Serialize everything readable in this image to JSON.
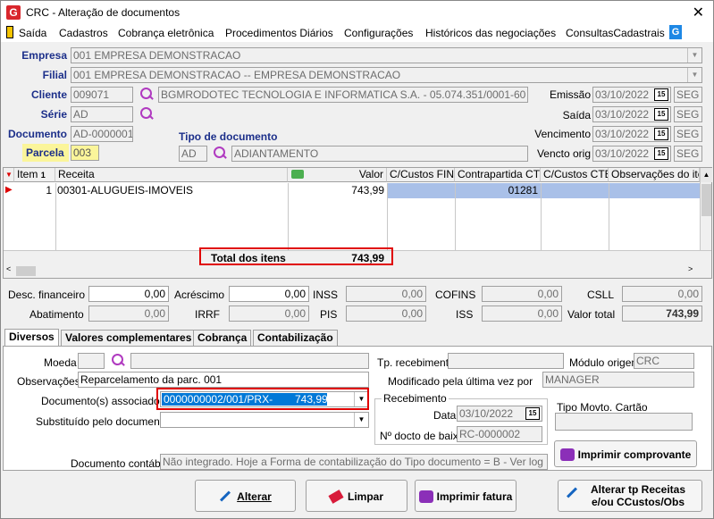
{
  "window": {
    "title": "CRC - Alteração de documentos",
    "close": "✕"
  },
  "menu": [
    "Saída",
    "Cadastros",
    "Cobrança eletrônica",
    "Procedimentos Diários",
    "Configurações",
    "Históricos das negociações",
    "ConsultasCadastrais"
  ],
  "form": {
    "empresa_label": "Empresa",
    "empresa": "001 EMPRESA DEMONSTRACAO",
    "filial_label": "Filial",
    "filial": "001 EMPRESA DEMONSTRACAO -- EMPRESA DEMONSTRACAO",
    "cliente_label": "Cliente",
    "cliente_code": "009071",
    "cliente_name": "BGMRODOTEC TECNOLOGIA E INFORMATICA S.A. - 05.074.351/0001-60",
    "serie_label": "Série",
    "serie": "AD",
    "documento_label": "Documento",
    "documento": "AD-0000001",
    "tipo_label": "Tipo de documento",
    "tipo_code": "AD",
    "tipo_name": "ADIANTAMENTO",
    "parcela_label": "Parcela",
    "parcela": "003",
    "emissao_label": "Emissão",
    "emissao": "03/10/2022",
    "emissao_dow": "SEG",
    "saida_label": "Saída",
    "saida": "03/10/2022",
    "saida_dow": "SEG",
    "vencimento_label": "Vencimento",
    "vencimento": "03/10/2022",
    "vencimento_dow": "SEG",
    "vencto_orig_label": "Vencto orig",
    "vencto_orig": "03/10/2022",
    "vencto_orig_dow": "SEG"
  },
  "grid": {
    "headers": [
      "Item",
      "Receita",
      "Valor",
      "C/Custos FIN",
      "Contrapartida CTB",
      "C/Custos CTB",
      "Observações do item"
    ],
    "rows": [
      {
        "item": "1",
        "receita": "00301-ALUGUEIS-IMOVEIS",
        "valor": "743,99",
        "ccfin": "",
        "contrapartida": "01281",
        "ccctb": "",
        "obs": ""
      }
    ],
    "total_label": "Total dos itens",
    "total_value": "743,99"
  },
  "totals": {
    "desc_fin_label": "Desc. financeiro",
    "desc_fin": "0,00",
    "acrescimo_label": "Acréscimo",
    "acrescimo": "0,00",
    "inss_label": "INSS",
    "inss": "0,00",
    "cofins_label": "COFINS",
    "cofins": "0,00",
    "csll_label": "CSLL",
    "csll": "0,00",
    "abatimento_label": "Abatimento",
    "abatimento": "0,00",
    "irrf_label": "IRRF",
    "irrf": "0,00",
    "pis_label": "PIS",
    "pis": "0,00",
    "iss_label": "ISS",
    "iss": "0,00",
    "valor_total_label": "Valor total",
    "valor_total": "743,99"
  },
  "tabs": [
    "Diversos",
    "Valores complementares",
    "Cobrança",
    "Contabilização"
  ],
  "diversos": {
    "moeda_label": "Moeda",
    "moeda": "",
    "tp_recebimento_label": "Tp. recebimento",
    "tp_recebimento": "",
    "modulo_origem_label": "Módulo origem",
    "modulo_origem": "CRC",
    "observacoes_label": "Observações",
    "observacoes": "Reparcelamento da parc. 001",
    "modificado_label": "Modificado pela última vez por",
    "modificado": "MANAGER",
    "doc_assoc_label": "Documento(s) associado(s)",
    "doc_assoc": "0000000002/001/PRX-",
    "doc_assoc_value": "743,99",
    "substituido_label": "Substituído pelo documento",
    "substituido": "",
    "recebimento_group": "Recebimento",
    "data_label": "Data",
    "data": "03/10/2022",
    "docto_baixa_label": "Nº docto de baixa",
    "docto_baixa": "RC-0000002",
    "tipo_movto_label": "Tipo Movto. Cartão",
    "tipo_movto": "",
    "doc_contabil_label": "Documento contábil",
    "doc_contabil": "Não integrado. Hoje a Forma de contabilização do Tipo documento = B - Ver log p/saber o",
    "imprimir_comprovante": "Imprimir comprovante"
  },
  "buttons": {
    "alterar": "Alterar",
    "limpar": "Limpar",
    "imprimir_fatura": "Imprimir fatura",
    "alterar_tp_1": "Alterar tp Receitas",
    "alterar_tp_2": "e/ou CCustos/Obs"
  }
}
